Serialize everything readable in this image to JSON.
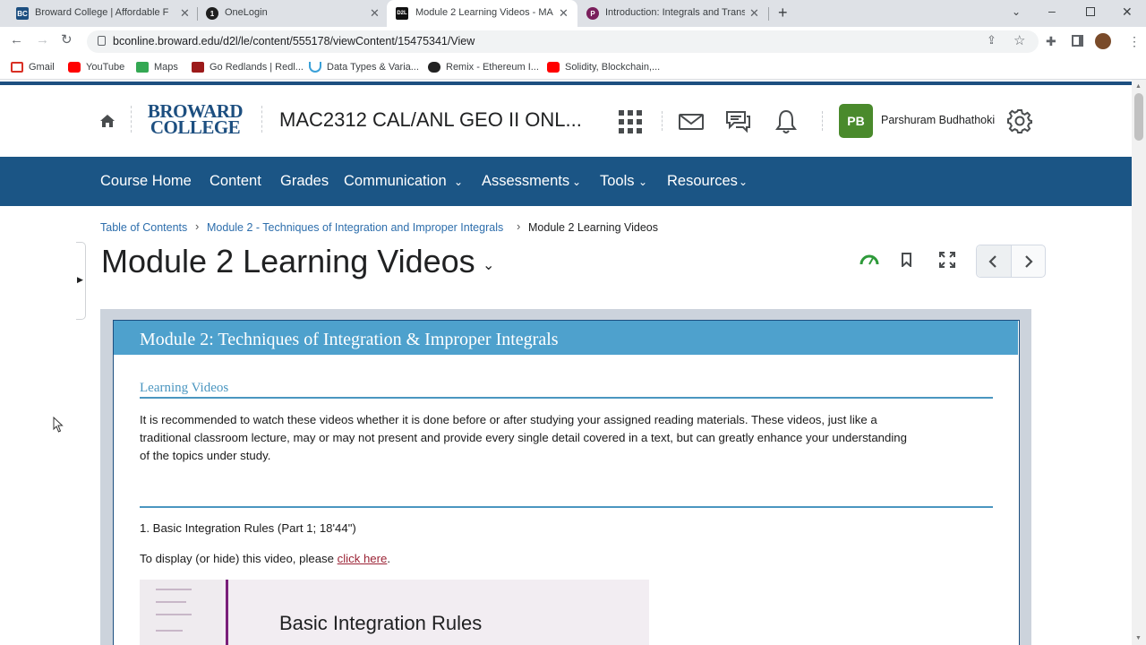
{
  "browser": {
    "tabs": [
      {
        "title": "Broward College | Affordable Flo",
        "favicon": "BC"
      },
      {
        "title": "OneLogin",
        "favicon": "1"
      },
      {
        "title": "Module 2 Learning Videos - MAC",
        "favicon": "D2L"
      },
      {
        "title": "Introduction: Integrals and Trans",
        "favicon": "P"
      }
    ],
    "url": "bconline.broward.edu/d2l/le/content/555178/viewContent/15475341/View",
    "bookmarks": [
      "Gmail",
      "YouTube",
      "Maps",
      "Go Redlands | Redl...",
      "Data Types & Varia...",
      "Remix - Ethereum I...",
      "Solidity, Blockchain,..."
    ]
  },
  "header": {
    "logo_line1": "BROWARD",
    "logo_line2": "COLLEGE",
    "course_title": "MAC2312 CAL/ANL GEO II ONL...",
    "user_initials": "PB",
    "user_name": "Parshuram Budhathoki"
  },
  "nav": {
    "items": [
      "Course Home",
      "Content",
      "Grades",
      "Communication",
      "Assessments",
      "Tools",
      "Resources"
    ]
  },
  "breadcrumb": {
    "items": [
      "Table of Contents",
      "Module 2 - Techniques of Integration and Improper Integrals",
      "Module 2 Learning Videos"
    ]
  },
  "page": {
    "title": "Module 2 Learning Videos"
  },
  "content": {
    "banner": "Module 2: Techniques of Integration & Improper Integrals",
    "section_heading": "Learning Videos",
    "paragraph_line1": "It is recommended to watch these videos whether it is done before or after studying your assigned reading materials. These videos, just like a",
    "paragraph_line2": "traditional classroom lecture, may or may not present and provide every single detail covered in a text, but can greatly enhance your understanding",
    "paragraph_line3": "of the topics under study.",
    "video1_title": "1. Basic Integration Rules (Part 1; 18'44\")",
    "video1_prompt": "To display (or hide) this video, please",
    "video1_link": "click here",
    "video1_thumb_title": "Basic Integration Rules"
  },
  "colors": {
    "nav_band": "#1b5585",
    "banner": "#4ea1cd",
    "link": "#2d6eac",
    "avatar": "#4a8a2c"
  }
}
